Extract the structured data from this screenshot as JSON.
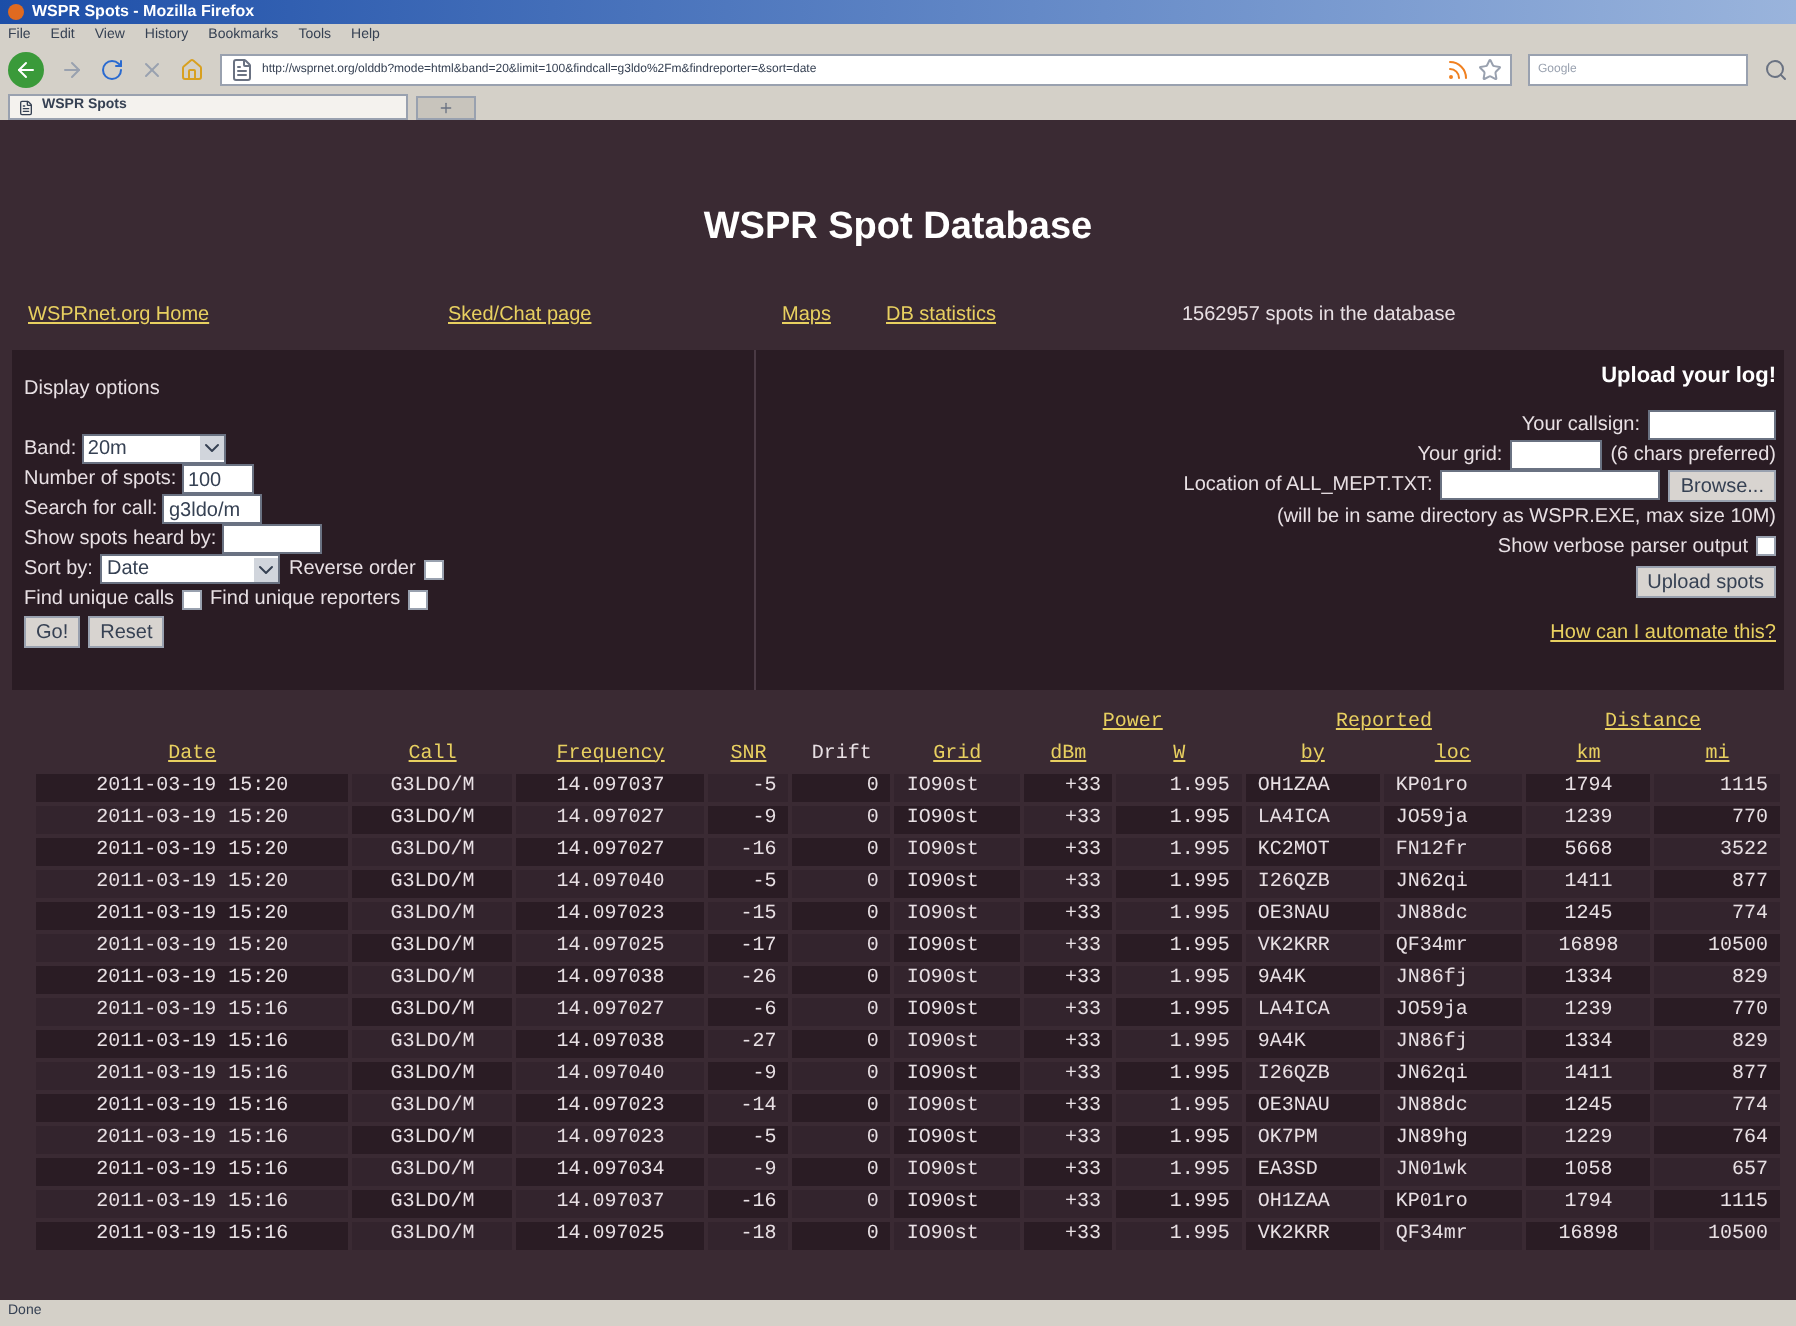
{
  "window": {
    "title": "WSPR Spots - Mozilla Firefox"
  },
  "menu": [
    "File",
    "Edit",
    "View",
    "History",
    "Bookmarks",
    "Tools",
    "Help"
  ],
  "address_bar": {
    "value": "http://wsprnet.org/olddb?mode=html&band=20&limit=100&findcall=g3ldo%2Fm&findreporter=&sort=date"
  },
  "search_bar": {
    "placeholder": "Google"
  },
  "tabs": [
    {
      "label": "WSPR Spots",
      "selected": true
    }
  ],
  "page": {
    "title": "WSPR Spot Database",
    "nav_links": [
      "WSPRnet.org Home",
      "Sked/Chat page",
      "Maps",
      "DB statistics"
    ],
    "spot_count": "1562957 spots in the database",
    "display_options": {
      "heading": "Display options",
      "band": {
        "label": "Band:",
        "value": "20m"
      },
      "number_of_spots": {
        "label": "Number of spots:",
        "value": "100"
      },
      "search_call": {
        "label": "Search for call:",
        "value": "g3ldo/m"
      },
      "heard_by": {
        "label": "Show spots heard by:"
      },
      "sort_by": {
        "label": "Sort by:",
        "value": "Date"
      },
      "reverse_order": {
        "label": "Reverse order",
        "checked": false
      },
      "unique_calls": {
        "label": "Find unique calls",
        "checked": false
      },
      "unique_reporters": {
        "label": "Find unique reporters",
        "checked": false
      },
      "buttons": [
        "Go!",
        "Reset"
      ]
    },
    "upload": {
      "heading": "Upload your log!",
      "callsign_label": "Your callsign:",
      "grid_label": "Your grid:",
      "grid_note": "(6 chars preferred)",
      "location_label": "Location of ALL_MEPT.TXT:",
      "browse_button": "Browse...",
      "note": "(will be in same directory as WSPR.EXE, max size 10M)",
      "verbose": {
        "label": "Show verbose parser output",
        "checked": false
      },
      "upload_button": "Upload spots",
      "automate_link": "How can I automate this?"
    },
    "table": {
      "groups": [
        {
          "label": "Power"
        },
        {
          "label": "Reported"
        },
        {
          "label": "Distance"
        }
      ],
      "columns": [
        {
          "label": "Date",
          "link": true
        },
        {
          "label": "Call",
          "link": true
        },
        {
          "label": "Frequency",
          "link": true
        },
        {
          "label": "SNR",
          "link": true
        },
        {
          "label": "Drift",
          "link": false
        },
        {
          "label": "Grid",
          "link": true
        },
        {
          "label": "dBm",
          "link": true
        },
        {
          "label": "W",
          "link": true
        },
        {
          "label": "by",
          "link": true
        },
        {
          "label": "loc",
          "link": true
        },
        {
          "label": "km",
          "link": true
        },
        {
          "label": "mi",
          "link": true
        }
      ],
      "rows": [
        [
          "2011-03-19 15:20",
          "G3LDO/M",
          "14.097037",
          "-5",
          "0",
          "IO90st",
          "+33",
          "1.995",
          "OH1ZAA",
          "KP01ro",
          "1794",
          "1115"
        ],
        [
          "2011-03-19 15:20",
          "G3LDO/M",
          "14.097027",
          "-9",
          "0",
          "IO90st",
          "+33",
          "1.995",
          "LA4ICA",
          "JO59ja",
          "1239",
          "770"
        ],
        [
          "2011-03-19 15:20",
          "G3LDO/M",
          "14.097027",
          "-16",
          "0",
          "IO90st",
          "+33",
          "1.995",
          "KC2MOT",
          "FN12fr",
          "5668",
          "3522"
        ],
        [
          "2011-03-19 15:20",
          "G3LDO/M",
          "14.097040",
          "-5",
          "0",
          "IO90st",
          "+33",
          "1.995",
          "I26QZB",
          "JN62qi",
          "1411",
          "877"
        ],
        [
          "2011-03-19 15:20",
          "G3LDO/M",
          "14.097023",
          "-15",
          "0",
          "IO90st",
          "+33",
          "1.995",
          "OE3NAU",
          "JN88dc",
          "1245",
          "774"
        ],
        [
          "2011-03-19 15:20",
          "G3LDO/M",
          "14.097025",
          "-17",
          "0",
          "IO90st",
          "+33",
          "1.995",
          "VK2KRR",
          "QF34mr",
          "16898",
          "10500"
        ],
        [
          "2011-03-19 15:20",
          "G3LDO/M",
          "14.097038",
          "-26",
          "0",
          "IO90st",
          "+33",
          "1.995",
          "9A4K",
          "JN86fj",
          "1334",
          "829"
        ],
        [
          "2011-03-19 15:16",
          "G3LDO/M",
          "14.097027",
          "-6",
          "0",
          "IO90st",
          "+33",
          "1.995",
          "LA4ICA",
          "JO59ja",
          "1239",
          "770"
        ],
        [
          "2011-03-19 15:16",
          "G3LDO/M",
          "14.097038",
          "-27",
          "0",
          "IO90st",
          "+33",
          "1.995",
          "9A4K",
          "JN86fj",
          "1334",
          "829"
        ],
        [
          "2011-03-19 15:16",
          "G3LDO/M",
          "14.097040",
          "-9",
          "0",
          "IO90st",
          "+33",
          "1.995",
          "I26QZB",
          "JN62qi",
          "1411",
          "877"
        ],
        [
          "2011-03-19 15:16",
          "G3LDO/M",
          "14.097023",
          "-14",
          "0",
          "IO90st",
          "+33",
          "1.995",
          "OE3NAU",
          "JN88dc",
          "1245",
          "774"
        ],
        [
          "2011-03-19 15:16",
          "G3LDO/M",
          "14.097023",
          "-5",
          "0",
          "IO90st",
          "+33",
          "1.995",
          "OK7PM",
          "JN89hg",
          "1229",
          "764"
        ],
        [
          "2011-03-19 15:16",
          "G3LDO/M",
          "14.097034",
          "-9",
          "0",
          "IO90st",
          "+33",
          "1.995",
          "EA3SD",
          "JN01wk",
          "1058",
          "657"
        ],
        [
          "2011-03-19 15:16",
          "G3LDO/M",
          "14.097037",
          "-16",
          "0",
          "IO90st",
          "+33",
          "1.995",
          "OH1ZAA",
          "KP01ro",
          "1794",
          "1115"
        ],
        [
          "2011-03-19 15:16",
          "G3LDO/M",
          "14.097025",
          "-18",
          "0",
          "IO90st",
          "+33",
          "1.995",
          "VK2KRR",
          "QF34mr",
          "16898",
          "10500"
        ]
      ]
    }
  },
  "status_bar": "Done"
}
